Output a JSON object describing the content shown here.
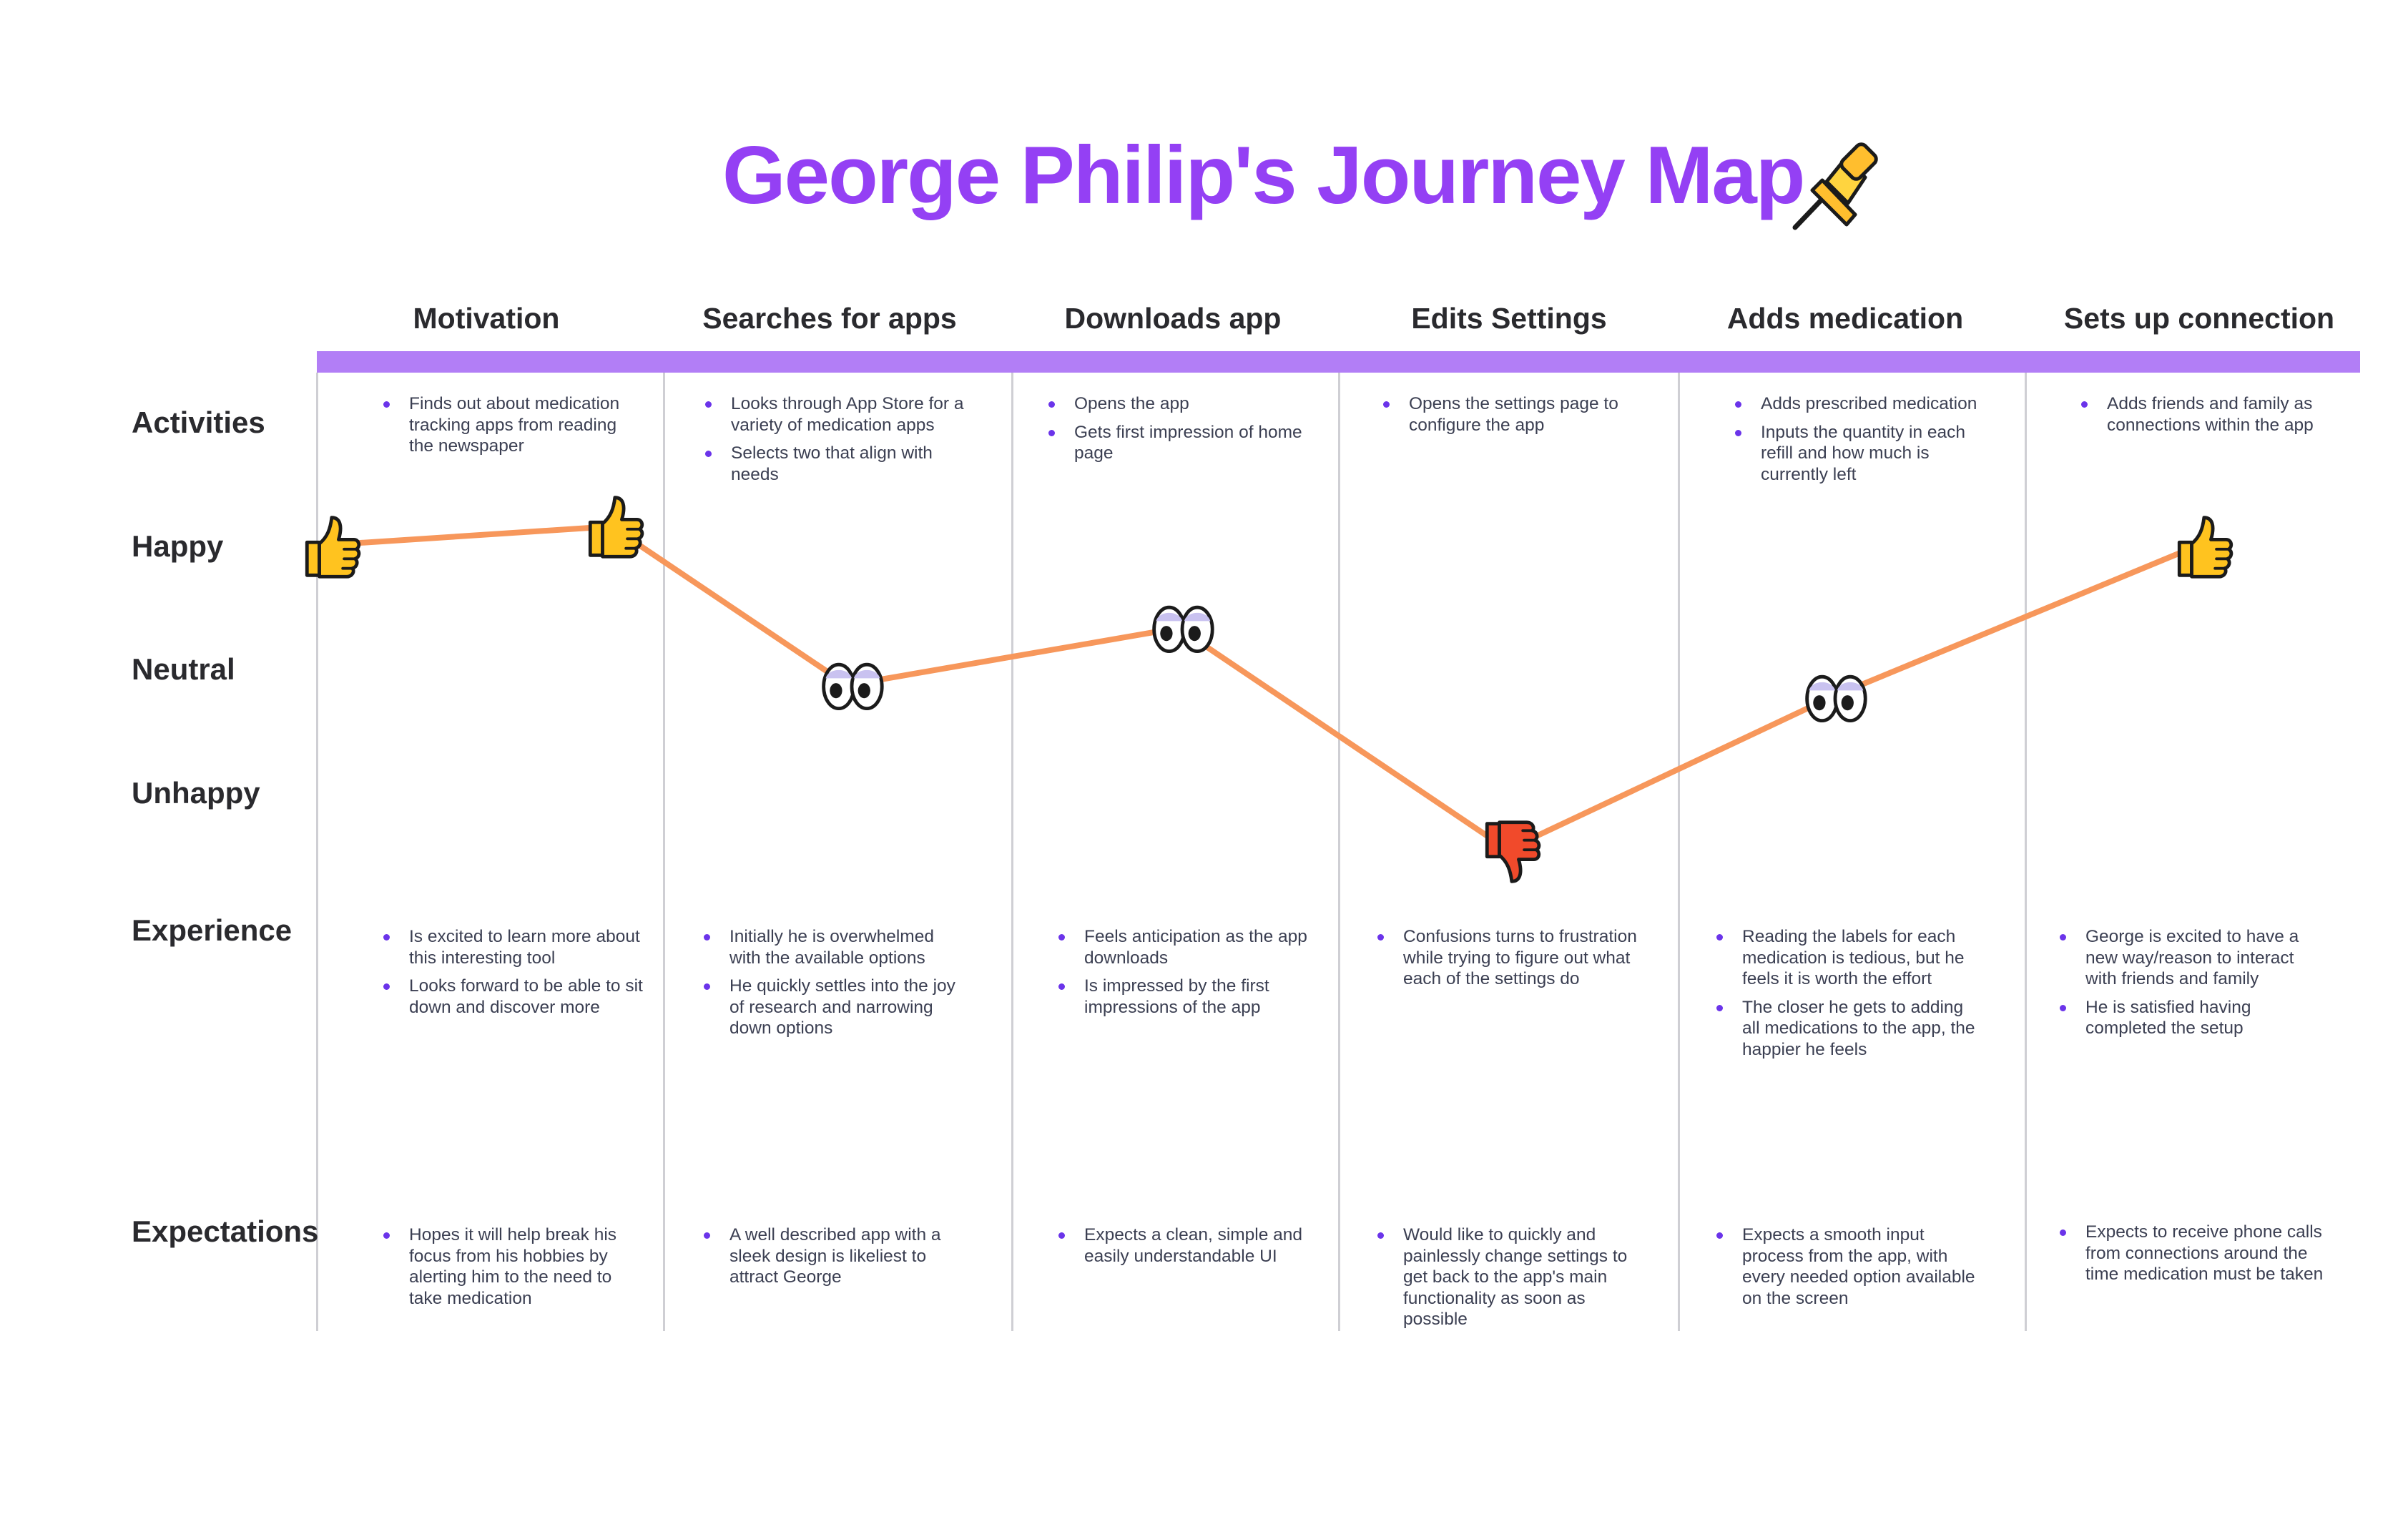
{
  "title": "George Philip's Journey Map",
  "stages": [
    "Motivation",
    "Searches for apps",
    "Downloads app",
    "Edits Settings",
    "Adds medication",
    "Sets up connection"
  ],
  "row_labels": {
    "activities": "Activities",
    "happy": "Happy",
    "neutral": "Neutral",
    "unhappy": "Unhappy",
    "experience": "Experience",
    "expectations": "Expectations"
  },
  "activities": [
    [
      "Finds out about medication tracking apps from reading the newspaper"
    ],
    [
      "Looks through App Store for a variety of medication apps",
      "Selects two that align with needs"
    ],
    [
      "Opens the app",
      "Gets first impression of home page"
    ],
    [
      "Opens the settings page to configure the app"
    ],
    [
      "Adds prescribed medication",
      "Inputs the quantity in each refill and how much is currently left"
    ],
    [
      "Adds friends and family as connections within the app"
    ]
  ],
  "experience": [
    [
      "Is excited to learn more about this interesting tool",
      "Looks forward to be able to sit down and discover more"
    ],
    [
      "Initially he is overwhelmed with the available options",
      "He quickly settles into the joy of research and narrowing down options"
    ],
    [
      "Feels anticipation as the app downloads",
      "Is impressed by the first impressions of the app"
    ],
    [
      "Confusions turns to frustration while trying to figure out what each of the settings do"
    ],
    [
      "Reading the labels for each medication is tedious, but he feels it is worth the effort",
      "The closer he gets to adding all medications to the app, the happier he feels"
    ],
    [
      "George is excited to have a new way/reason to interact with friends and family",
      "He is satisfied having completed the setup"
    ]
  ],
  "expectations": [
    [
      " Hopes it will help break his focus from his hobbies by alerting him to the need to take medication"
    ],
    [
      "A well described app with a sleek design is likeliest to attract George"
    ],
    [
      "Expects a clean, simple and easily understandable UI"
    ],
    [
      "Would like to quickly and painlessly change settings to get back to the app's main functionality as soon as possible"
    ],
    [
      " Expects a smooth input process from the app, with every needed option available on the screen"
    ],
    [
      "Expects to receive phone calls from connections around the time medication must be taken"
    ]
  ],
  "sentiment_points": [
    {
      "stage": "start",
      "mood": "happy",
      "icon": "thumbs-up-icon"
    },
    {
      "stage": "Motivation",
      "mood": "happy",
      "icon": "thumbs-up-icon"
    },
    {
      "stage": "Searches for apps",
      "mood": "neutral",
      "icon": "eyes-icon"
    },
    {
      "stage": "Downloads app",
      "mood": "neutral",
      "icon": "eyes-icon"
    },
    {
      "stage": "Edits Settings",
      "mood": "unhappy",
      "icon": "thumbs-down-icon"
    },
    {
      "stage": "Adds medication",
      "mood": "neutral",
      "icon": "eyes-icon"
    },
    {
      "stage": "Sets up connection",
      "mood": "happy",
      "icon": "thumbs-up-icon"
    }
  ],
  "colors": {
    "title": "#9440f4",
    "header_bar": "#b27ef6",
    "curve": "#f7975b",
    "bullet": "#6b34ea",
    "thumbs_up": "#ffc31f",
    "thumbs_down": "#f14a2b"
  }
}
